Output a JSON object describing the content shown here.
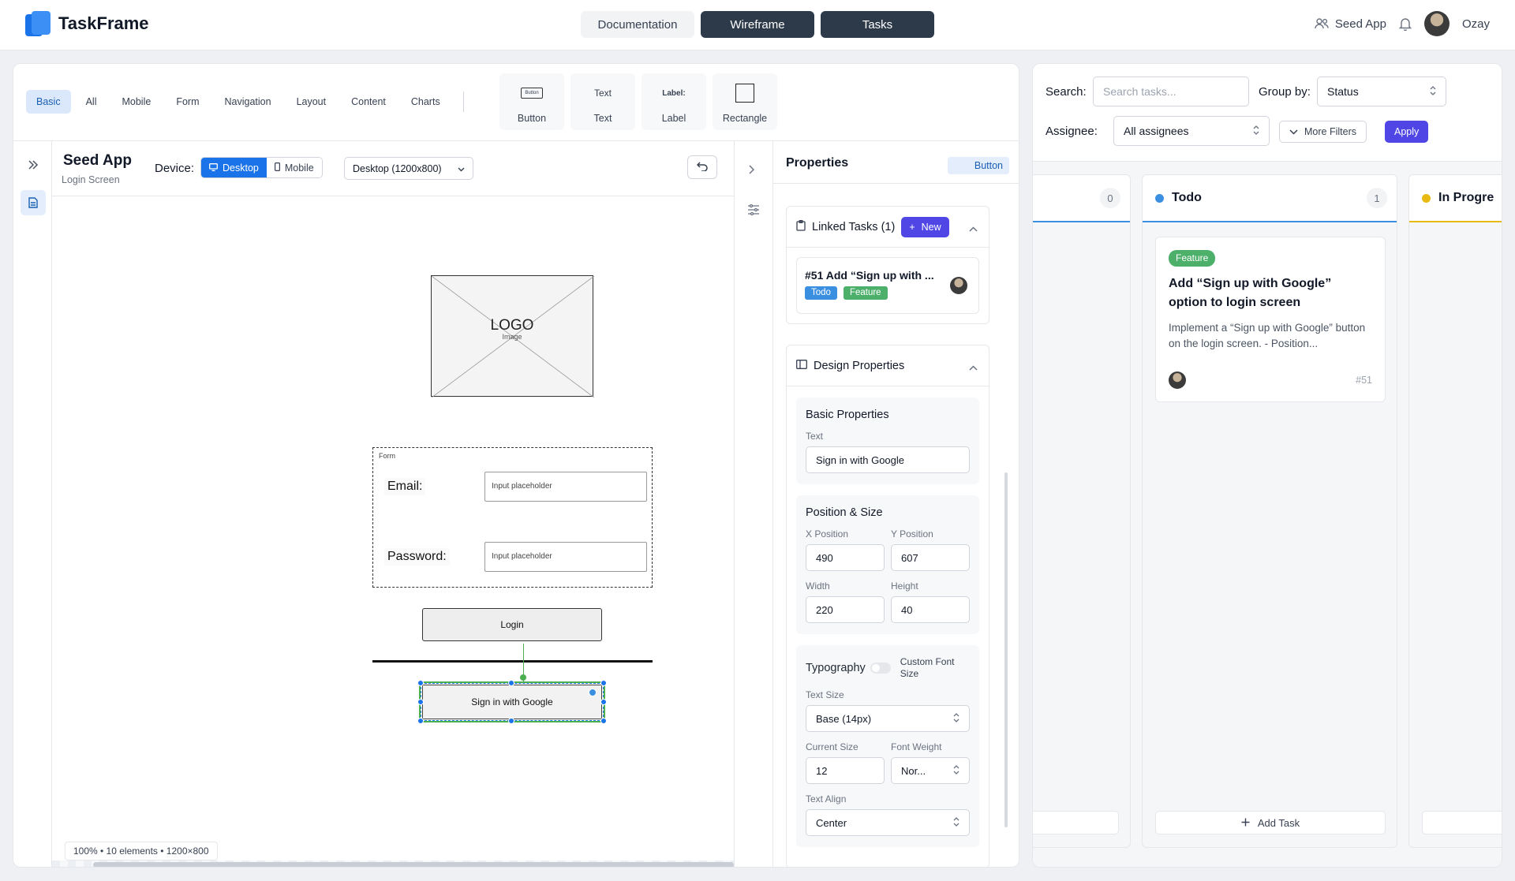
{
  "app": {
    "name": "TaskFrame"
  },
  "top_nav": {
    "tabs": [
      {
        "label": "Documentation",
        "active": false
      },
      {
        "label": "Wireframe",
        "active": true
      },
      {
        "label": "Tasks",
        "active": true
      }
    ],
    "project_label": "Seed App",
    "user_name": "Ozay"
  },
  "toolbar": {
    "categories": [
      "Basic",
      "All",
      "Mobile",
      "Form",
      "Navigation",
      "Layout",
      "Content",
      "Charts"
    ],
    "active_category": "Basic",
    "elements": [
      {
        "label": "Button",
        "preview": "Button"
      },
      {
        "label": "Text",
        "preview": "Text"
      },
      {
        "label": "Label",
        "preview": "Label:"
      },
      {
        "label": "Rectangle",
        "preview": ""
      }
    ]
  },
  "canvas_header": {
    "title": "Seed App",
    "subtitle": "Login Screen",
    "device_label": "Device:",
    "device_options": [
      "Desktop",
      "Mobile"
    ],
    "device_selected": "Desktop",
    "resolution": "Desktop (1200x800)"
  },
  "wireframe": {
    "image_label": "LOGO",
    "image_sublabel": "Image",
    "form_label": "Form",
    "email_label": "Email:",
    "password_label": "Password:",
    "input_placeholder": "Input placeholder",
    "login_button": "Login",
    "google_button": "Sign in with Google"
  },
  "canvas_status": "100% • 10 elements • 1200×800",
  "properties": {
    "title": "Properties",
    "element_type": "Button",
    "linked_tasks": {
      "title": "Linked Tasks (1)",
      "new_label": "New",
      "task": {
        "title": "#51 Add “Sign up with ...",
        "status": "Todo",
        "type": "Feature"
      }
    },
    "design": {
      "title": "Design Properties",
      "basic": {
        "title": "Basic Properties",
        "text_label": "Text",
        "text_value": "Sign in with Google"
      },
      "position": {
        "title": "Position & Size",
        "x_label": "X Position",
        "x_value": "490",
        "y_label": "Y Position",
        "y_value": "607",
        "width_label": "Width",
        "width_value": "220",
        "height_label": "Height",
        "height_value": "40"
      },
      "typography": {
        "title": "Typography",
        "custom_font_label": "Custom Font Size",
        "text_size_label": "Text Size",
        "text_size_value": "Base (14px)",
        "current_size_label": "Current Size",
        "current_size_value": "12",
        "font_weight_label": "Font Weight",
        "font_weight_value": "Nor...",
        "text_align_label": "Text Align",
        "text_align_value": "Center"
      }
    }
  },
  "board": {
    "search_label": "Search:",
    "search_placeholder": "Search tasks...",
    "group_by_label": "Group by:",
    "group_by_value": "Status",
    "assignee_label": "Assignee:",
    "assignee_value": "All assignees",
    "more_filters": "More Filters",
    "apply": "Apply",
    "columns": [
      {
        "title": "",
        "count": "0"
      },
      {
        "title": "Todo",
        "count": "1",
        "color": "#3b8fe0"
      },
      {
        "title": "In Progre",
        "count": "",
        "color": "#e8b90f"
      }
    ],
    "card": {
      "tag": "Feature",
      "title": "Add “Sign up with Google” option to login screen",
      "description": "Implement a “Sign up with Google” button on the login screen. - Position...",
      "id": "#51"
    },
    "add_task": "Add Task"
  }
}
